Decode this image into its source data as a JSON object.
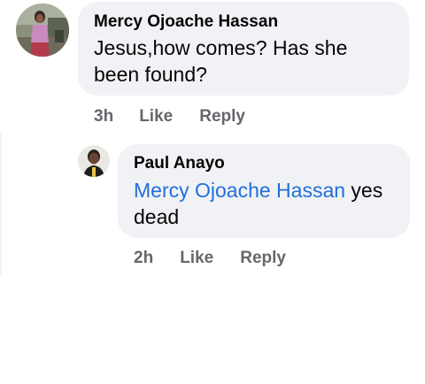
{
  "comments": [
    {
      "author": "Mercy Ojoache Hassan",
      "text": "Jesus,how comes?  Has she been found?",
      "time": "3h",
      "like_label": "Like",
      "reply_label": "Reply",
      "avatar_icon": "profile-photo-icon"
    }
  ],
  "replies": [
    {
      "author": "Paul Anayo",
      "mention": "Mercy Ojoache Hassan",
      "text": " yes dead",
      "time": "2h",
      "like_label": "Like",
      "reply_label": "Reply",
      "avatar_icon": "profile-photo-icon"
    }
  ],
  "colors": {
    "bubble": "#f0f2f5",
    "meta": "#65676b",
    "mention": "#216fdb",
    "text": "#050505"
  }
}
